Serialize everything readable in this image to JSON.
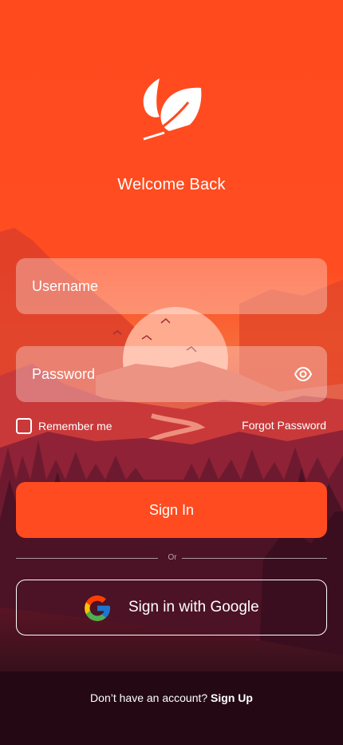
{
  "colors": {
    "accent": "#ff4b1f",
    "sky_top": "#ff4a1e",
    "sky_horizon": "#f86a3a",
    "sun": "#ffab90",
    "ground_dark": "#2a0a14",
    "text": "#ffffff"
  },
  "header": {
    "logo_icon": "leaf-icon",
    "title": "Welcome Back"
  },
  "form": {
    "username": {
      "placeholder": "Username",
      "value": ""
    },
    "password": {
      "placeholder": "Password",
      "value": "",
      "toggle_icon": "eye-icon"
    },
    "remember_label": "Remember me",
    "remember_checked": false,
    "forgot_label": "Forgot Password",
    "signin_label": "Sign In"
  },
  "divider": {
    "label": "Or"
  },
  "google": {
    "icon": "google-icon",
    "label": "Sign in with Google"
  },
  "footer": {
    "prompt": "Don’t have an account?",
    "signup_label": "Sign Up"
  }
}
